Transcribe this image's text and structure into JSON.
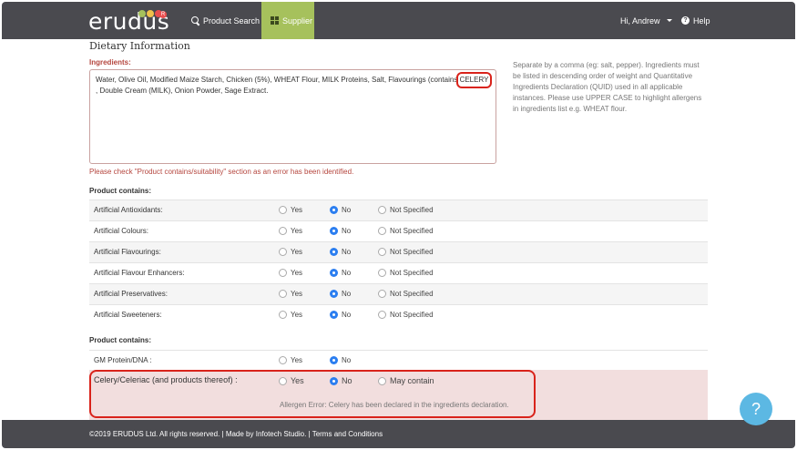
{
  "navbar": {
    "logo": "erudus",
    "logo_badge": "R",
    "logo_colors": [
      "#a6c15c",
      "#f0c14b",
      "#e94e4e"
    ],
    "product_search": "Product Search",
    "supplier": "Supplier",
    "user": "Hi, Andrew",
    "help": "Help",
    "active_color": "#a6c15c"
  },
  "section_title": "Dietary Information",
  "ingredients": {
    "label": "Ingredients:",
    "text_before": "Water, Olive Oil, Modified Maize Starch, Chicken (5%), WHEAT Flour, MILK Proteins, Salt, Flavourings (contains",
    "highlight": "CELERY",
    "text_after": ", Double Cream (MILK), Onion Powder, Sage Extract.",
    "help": "Separate by a comma (eg: salt, pepper). Ingredients must be listed in descending order of weight and Quantitative Ingredients Declaration (QUID) used in all applicable instances. Please use UPPER CASE to highlight allergens in ingredients list e.g. WHEAT flour.",
    "error": "Please check \"Product contains/suitability\" section as an error has been identified."
  },
  "product_contains_1": {
    "label": "Product contains:",
    "options": [
      "Yes",
      "No",
      "Not Specified"
    ],
    "rows": [
      {
        "label": "Artificial Antioxidants:",
        "selected": "No"
      },
      {
        "label": "Artificial Colours:",
        "selected": "No"
      },
      {
        "label": "Artificial Flavourings:",
        "selected": "No"
      },
      {
        "label": "Artificial Flavour Enhancers:",
        "selected": "No"
      },
      {
        "label": "Artificial Preservatives:",
        "selected": "No"
      },
      {
        "label": "Artificial Sweeteners:",
        "selected": "No"
      }
    ]
  },
  "product_contains_2": {
    "label": "Product contains:",
    "gm": {
      "label": "GM Protein/DNA :",
      "opt_yes": "Yes",
      "opt_no": "No",
      "selected": "No"
    },
    "celery": {
      "label": "Celery/Celeriac (and products thereof) :",
      "opt_yes": "Yes",
      "opt_no": "No",
      "opt_may": "May contain",
      "selected": "No"
    },
    "allergen_error": "Allergen Error: Celery has been declared in the ingredients declaration."
  },
  "footer": {
    "text": "©2019 ERUDUS Ltd. All rights reserved. | Made by Infotech Studio. | Terms and Conditions"
  },
  "help_fab": "?",
  "colors": {
    "error": "#b5463e",
    "highlight_outline": "#d9231b",
    "radio_selected": "#2b7ef0",
    "error_bg": "#f2dede",
    "navbar": "#4a4a4f"
  }
}
